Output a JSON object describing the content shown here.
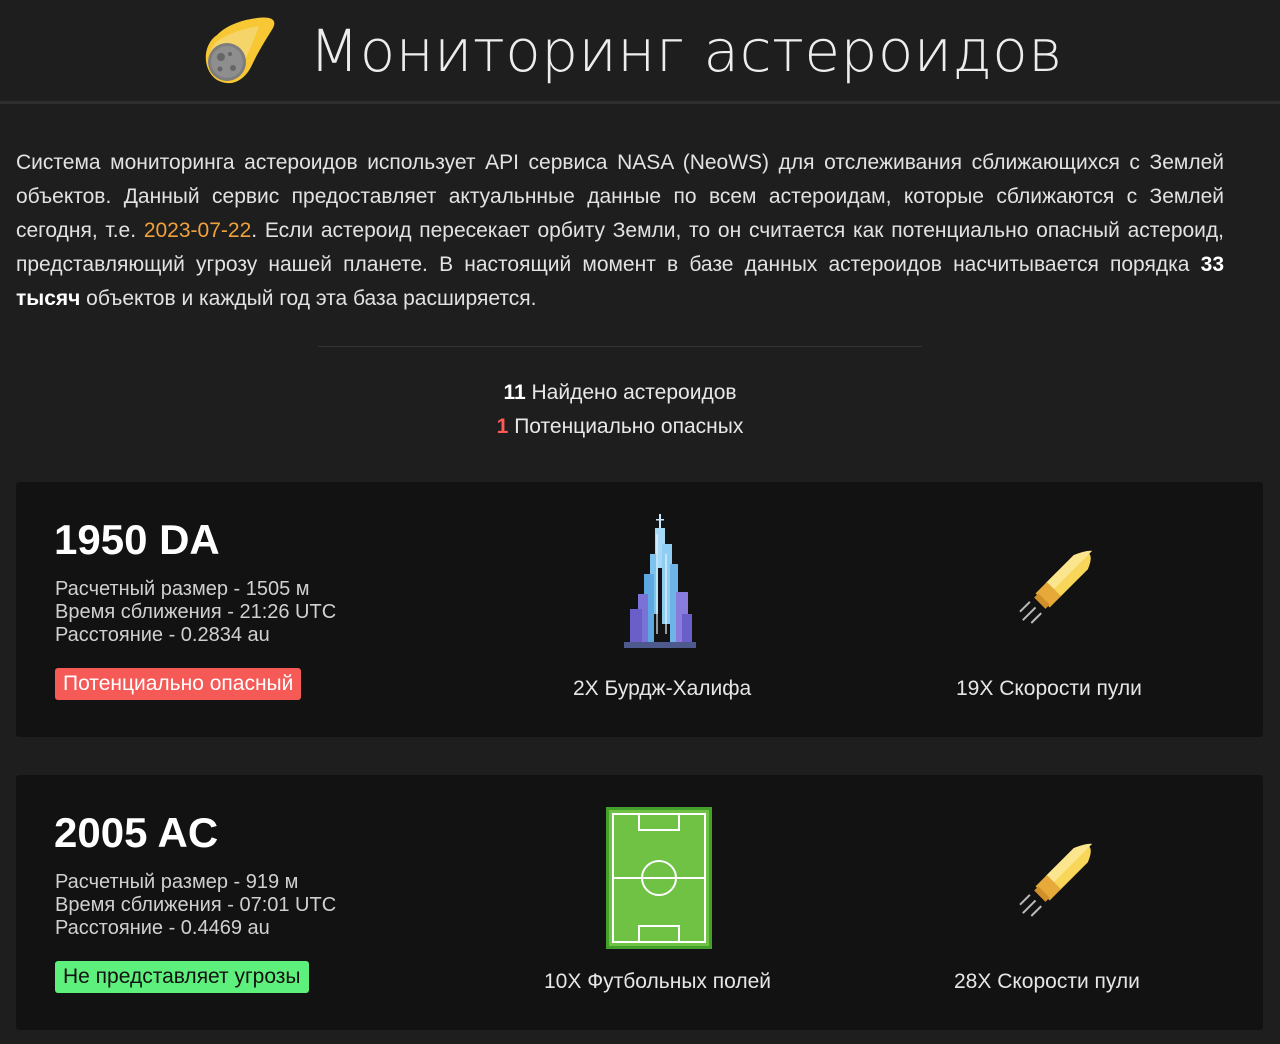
{
  "header": {
    "title": "Мониторинг астероидов",
    "logo_icon": "comet-icon"
  },
  "intro": {
    "part1": "Система мониторинга астероидов использует API сервиса NASA (NeoWS) для отслеживания сближающихся с Землей объектов. Данный сервис предоставляет актуальнные данные по всем астероидам, которые сближаются с Землей сегодня, т.е. ",
    "date": "2023-07-22",
    "part2": ". Если астероид пересекает орбиту Земли, то он считается как потенциально опасный астероид, представляющий угрозу нашей планете. В настоящий момент в базе данных астероидов насчитывается порядка ",
    "count": "33 тысяч",
    "part3": " объектов и каждый год эта база расширяется."
  },
  "stats": {
    "found_count": "11",
    "found_label": " Найдено астероидов",
    "danger_count": "1",
    "danger_label": " Потенциально опасных"
  },
  "asteroids": [
    {
      "name": "1950 DA",
      "size": "Расчетный размер - 1505 м",
      "time": "Время сближения - 21:26 UTC",
      "distance": "Расстояние - 0.2834 au",
      "badge": "Потенциально опасный",
      "size_icon": "burj-khalifa-icon",
      "size_caption": "2X Бурдж-Халифа",
      "speed_icon": "bullet-icon",
      "speed_caption": "19X Скорости пули"
    },
    {
      "name": "2005 AC",
      "size": "Расчетный размер - 919 м",
      "time": "Время сближения - 07:01 UTC",
      "distance": "Расстояние - 0.4469 au",
      "badge": "Не представляет угрозы",
      "size_icon": "football-field-icon",
      "size_caption": "10X Футбольных полей",
      "speed_icon": "bullet-icon",
      "speed_caption": "28X Скорости пули"
    }
  ],
  "colors": {
    "accent_date": "#f0a13b",
    "danger": "#f55a57",
    "safe": "#5ef07c"
  }
}
